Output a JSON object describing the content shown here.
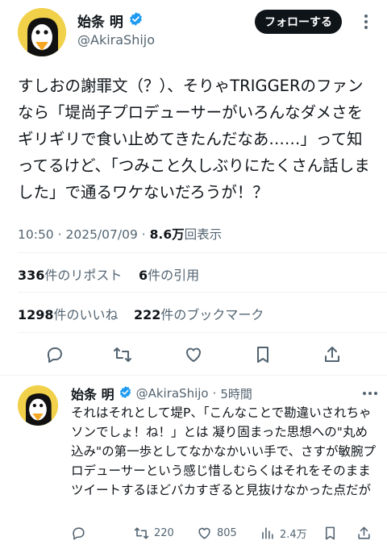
{
  "main_tweet": {
    "author_name": "始条 明",
    "handle": "@AkiraShijo",
    "follow_label": "フォローする",
    "text": "すしおの謝罪文（？）、そりゃTRIGGERのファンなら「堤尚子プロデューサーがいろんなダメさをギリギリで食い止めてきたんだなあ……」って知ってるけど、「つみこと久しぶりにたくさん話しました」で通るワケないだろうが！？",
    "time": "10:50",
    "sep": "·",
    "date": "2025/07/09",
    "sep2": "·",
    "views_count": "8.6万",
    "views_label": "回表示",
    "reposts_count": "336",
    "reposts_label": "件のリポスト",
    "quotes_count": "6",
    "quotes_label": "件の引用",
    "likes_count": "1298",
    "likes_label": "件のいいね",
    "bookmarks_count": "222",
    "bookmarks_label": "件のブックマーク"
  },
  "reply_tweet": {
    "author_name": "始条 明",
    "handle": "@AkiraShijo",
    "sep": "·",
    "time_ago": "5時間",
    "text": "それはそれとして堤P、「こんなことで勘違いされちゃソンでしょ！ね！」とは 凝り固まった思想への\"丸め込み\"の第一歩としてなかなかいい手で、さすが敏腕プロデューサーという感じ惜しむらくはそれをそのままツイートするほどバカすぎると見抜けなかった点だが",
    "reposts": "220",
    "likes": "805",
    "views": "2.4万"
  },
  "icons": [
    "verified-badge",
    "more-icon",
    "reply-icon",
    "repost-icon",
    "like-icon",
    "bookmark-icon",
    "share-icon",
    "views-icon"
  ],
  "colors": {
    "verified": "#1d9bf0",
    "text": "#0f1419",
    "secondary": "#536471",
    "avatar_bg": "#f1d14a"
  }
}
